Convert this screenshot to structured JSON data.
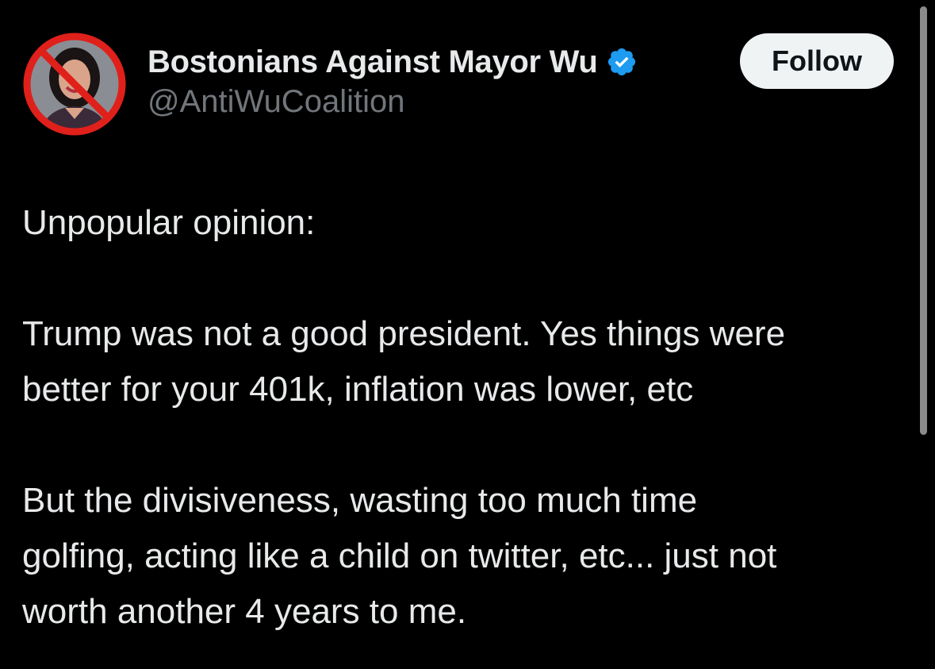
{
  "tweet": {
    "author": {
      "display_name": "Bostonians Against Mayor Wu",
      "handle": "@AntiWuCoalition",
      "verified": true,
      "avatar_icon": "no-symbol-over-portrait",
      "verified_icon": "verified-badge-icon"
    },
    "follow_label": "Follow",
    "paragraphs": [
      {
        "lines": [
          "Unpopular opinion:"
        ]
      },
      {
        "lines": [
          "Trump was not a good president. Yes things were",
          "better for your 401k, inflation was lower, etc"
        ]
      },
      {
        "lines": [
          "But the divisiveness, wasting too much time",
          "golfing, acting like a child on twitter, etc... just not",
          "worth another 4 years to me."
        ]
      }
    ]
  },
  "colors": {
    "background": "#000000",
    "text_primary": "#e7e9ea",
    "text_secondary": "#71767b",
    "verified_blue": "#1d9bf0",
    "follow_bg": "#eff3f4",
    "no_symbol_red": "#e0201b"
  }
}
